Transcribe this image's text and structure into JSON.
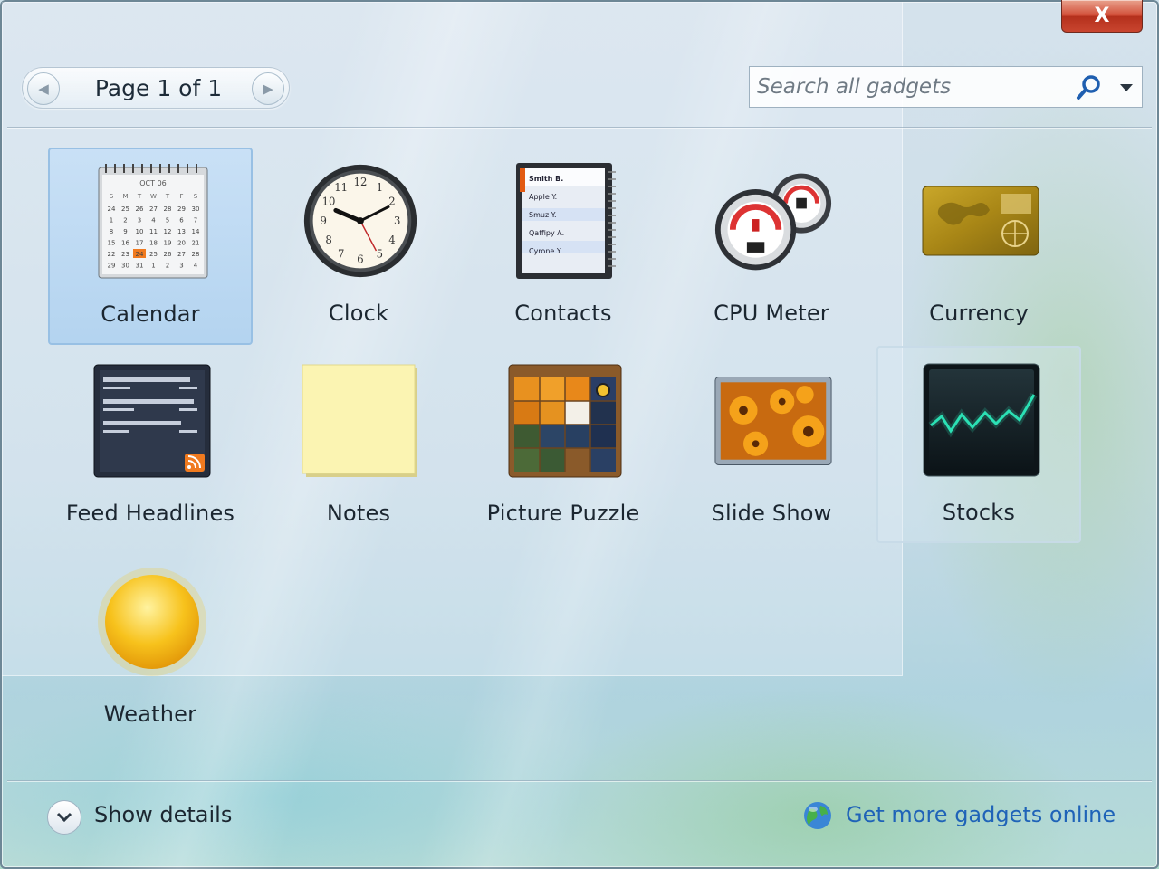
{
  "window": {
    "close_label": "X"
  },
  "pager": {
    "label": "Page 1 of 1"
  },
  "search": {
    "placeholder": "Search all gadgets"
  },
  "gadgets": [
    {
      "label": "Calendar",
      "icon": "calendar-icon",
      "state": "selected"
    },
    {
      "label": "Clock",
      "icon": "clock-icon"
    },
    {
      "label": "Contacts",
      "icon": "contacts-icon"
    },
    {
      "label": "CPU Meter",
      "icon": "cpu-meter-icon"
    },
    {
      "label": "Currency",
      "icon": "currency-icon"
    },
    {
      "label": "Feed Headlines",
      "icon": "feed-headlines-icon"
    },
    {
      "label": "Notes",
      "icon": "notes-icon"
    },
    {
      "label": "Picture Puzzle",
      "icon": "picture-puzzle-icon"
    },
    {
      "label": "Slide Show",
      "icon": "slide-show-icon"
    },
    {
      "label": "Stocks",
      "icon": "stocks-icon",
      "state": "hover"
    },
    {
      "label": "Weather",
      "icon": "weather-icon"
    }
  ],
  "calendar_icon": {
    "month": "OCT 06",
    "weekdays": [
      "S",
      "M",
      "T",
      "W",
      "T",
      "F",
      "S"
    ],
    "days": [
      "24",
      "25",
      "26",
      "27",
      "28",
      "29",
      "30",
      "1",
      "2",
      "3",
      "4",
      "5",
      "6",
      "7",
      "8",
      "9",
      "10",
      "11",
      "12",
      "13",
      "14",
      "15",
      "16",
      "17",
      "18",
      "19",
      "20",
      "21",
      "22",
      "23",
      "24",
      "25",
      "26",
      "27",
      "28",
      "29",
      "30",
      "31",
      "1",
      "2",
      "3",
      "4"
    ],
    "highlight_day": "24"
  },
  "contacts_icon": {
    "names": [
      "Smith B.",
      "Apple Y.",
      "Smuz Y.",
      "Qaffipy A.",
      "Cyrone Y."
    ]
  },
  "footer": {
    "details_label": "Show details",
    "more_link": "Get more gadgets online"
  },
  "colors": {
    "link": "#1f63b8",
    "close": "#c9452f",
    "selected_tile": "#b0d2f0"
  }
}
